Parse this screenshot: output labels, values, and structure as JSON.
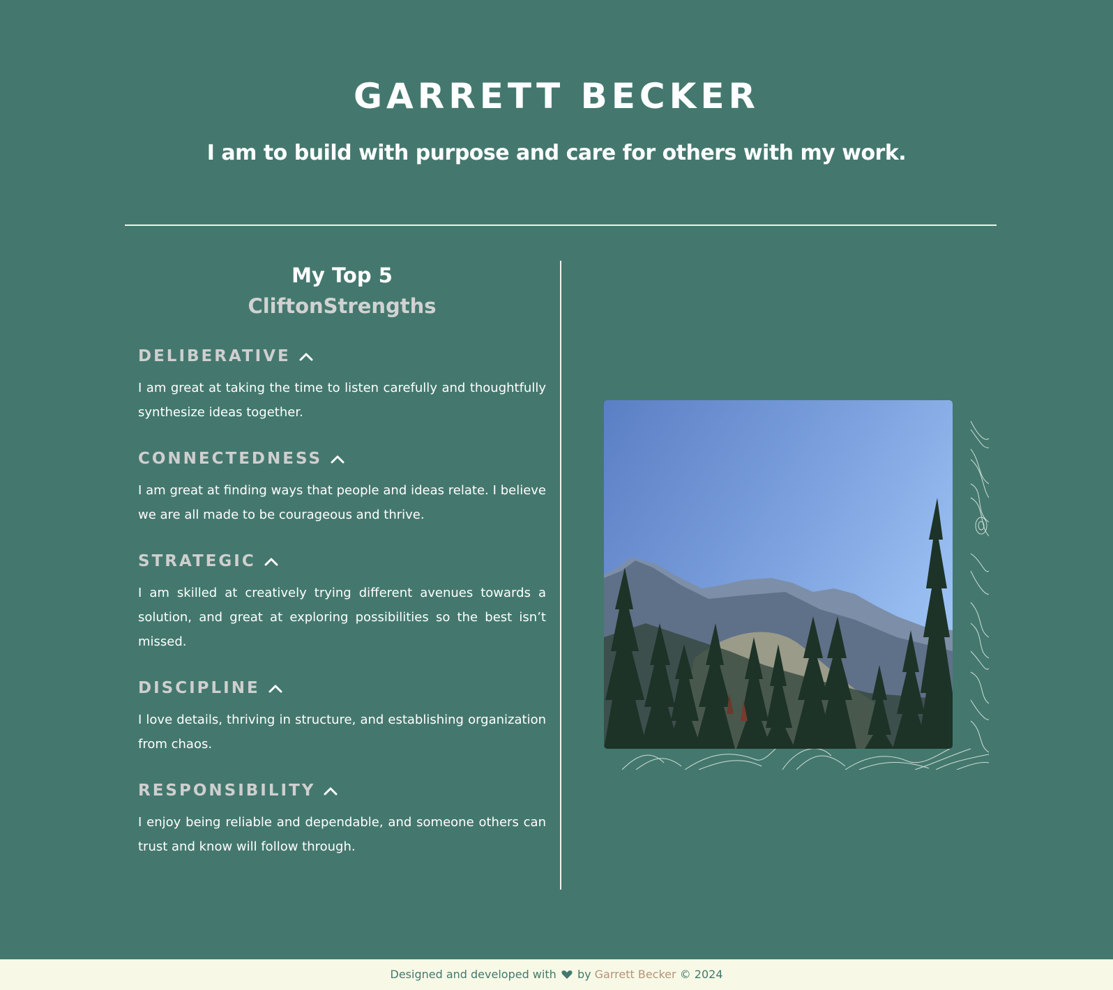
{
  "header": {
    "name": "GARRETT BECKER",
    "mission": "I am to build with purpose and care for others with my work."
  },
  "strengths_section": {
    "title": "My Top 5",
    "subtitle": "CliftonStrengths",
    "items": [
      {
        "name": "DELIBERATIVE",
        "icon": "chevron-up-icon",
        "text": "I am great at taking the time to listen carefully and thoughtfully synthesize ideas together."
      },
      {
        "name": "CONNECTEDNESS",
        "icon": "chevron-up-icon",
        "text": "I am great at finding ways that people and ideas relate. I believe we are all made to be courageous and thrive."
      },
      {
        "name": "STRATEGIC",
        "icon": "chevron-up-icon",
        "text": "I am skilled at creatively trying different avenues towards a solution, and great at exploring possibilities so the best isn’t missed."
      },
      {
        "name": "DISCIPLINE",
        "icon": "chevron-up-icon",
        "text": "I love details, thriving in structure, and establishing organization from chaos."
      },
      {
        "name": "RESPONSIBILITY",
        "icon": "chevron-up-icon",
        "text": "I enjoy being reliable and dependable, and someone others can trust and know will follow through."
      }
    ]
  },
  "photo": {
    "description_icon": "mountain-landscape-photo",
    "decoration": "topographic-lines"
  },
  "footer": {
    "prefix": "Designed and developed with",
    "heart_icon": "heart-icon",
    "by": "by",
    "author": "Garrett Becker",
    "suffix": "© 2024"
  },
  "colors": {
    "background": "#44786e",
    "footer_bg": "#f7f9e6",
    "author_link": "#b5937a",
    "strength_heading": "#cfcfcf"
  }
}
